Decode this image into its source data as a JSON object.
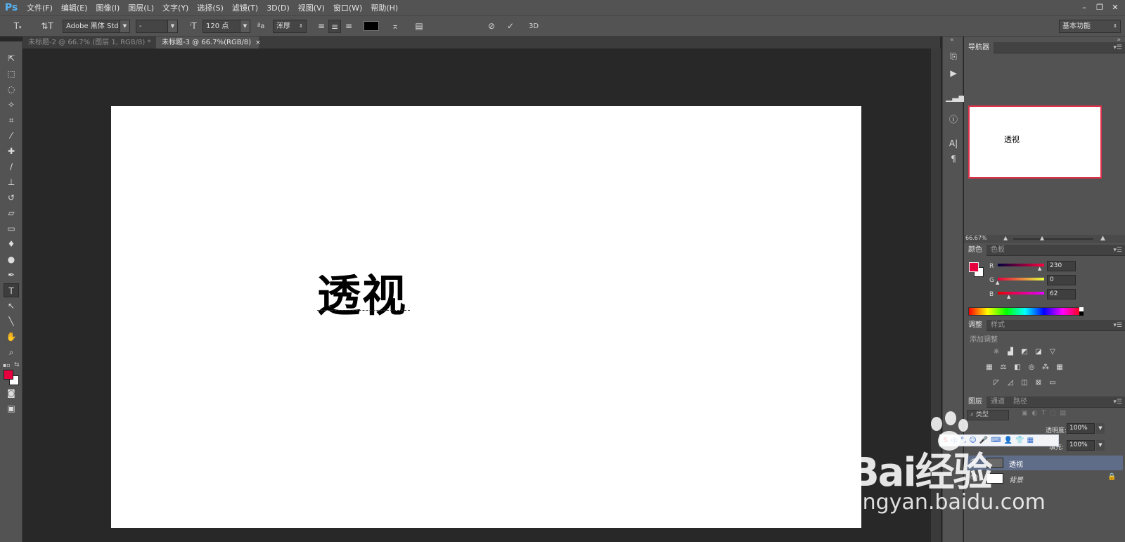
{
  "app": {
    "logo": "Ps"
  },
  "menu": [
    "文件(F)",
    "编辑(E)",
    "图像(I)",
    "图层(L)",
    "文字(Y)",
    "选择(S)",
    "滤镜(T)",
    "3D(D)",
    "视图(V)",
    "窗口(W)",
    "帮助(H)"
  ],
  "window_controls": [
    "–",
    "❐",
    "✕"
  ],
  "options": {
    "font_family": "Adobe 黑体 Std",
    "font_style": "-",
    "font_size": "120 点",
    "aa_label": "ªa",
    "antialias": "浑厚",
    "mode_3d": "3D",
    "workspace": "基本功能"
  },
  "tabs": [
    {
      "label": "未标题-2 @ 66.7% (图层 1, RGB/8) *",
      "close": "×"
    },
    {
      "label": "未标题-3 @ 66.7%(RGB/8)",
      "close": "×"
    }
  ],
  "canvas": {
    "text": "透视"
  },
  "navigator": {
    "title": "导航器",
    "thumb_text": "透视",
    "zoom": "66.67%"
  },
  "color_panel": {
    "tabs": [
      "颜色",
      "色板"
    ],
    "channels": [
      {
        "label": "R",
        "value": "230"
      },
      {
        "label": "G",
        "value": "0"
      },
      {
        "label": "B",
        "value": "62"
      }
    ],
    "foreground": "#e6003e",
    "background": "#ffffff"
  },
  "adjustments": {
    "tabs": [
      "调整",
      "样式"
    ],
    "subtitle": "添加调整"
  },
  "layers": {
    "tabs": [
      "图层",
      "通道",
      "路径"
    ],
    "filter_kind": "类型",
    "opacity_label": "透明度:",
    "opacity": "100%",
    "fill_label": "填充:",
    "fill": "100%",
    "items": [
      {
        "name": "透视",
        "selected": true
      },
      {
        "name": "背景",
        "locked": true
      }
    ]
  },
  "watermark": {
    "brand": "Bai经验",
    "url": "jingyan.baidu.com"
  }
}
